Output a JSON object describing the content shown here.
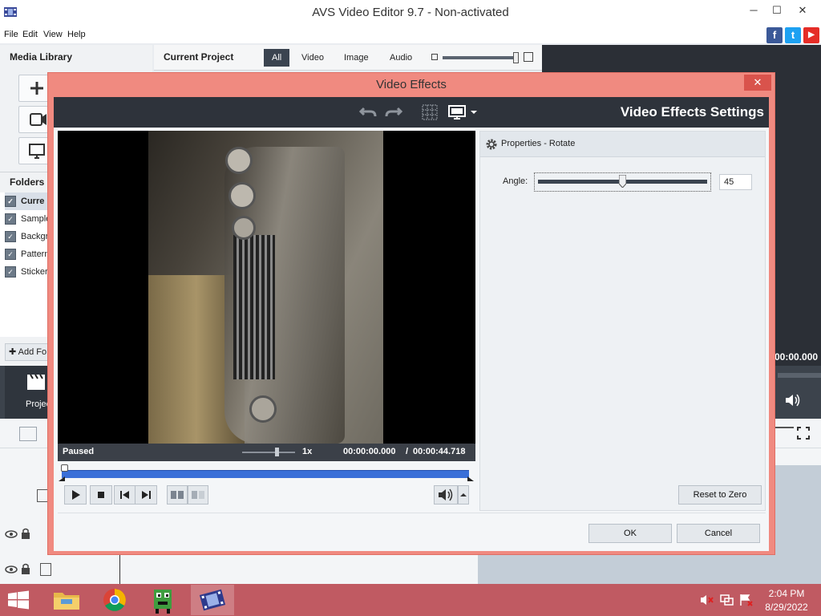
{
  "window": {
    "title": "AVS Video Editor 9.7 - Non-activated"
  },
  "menu": [
    "File",
    "Edit",
    "View",
    "Help"
  ],
  "social": [
    {
      "name": "facebook",
      "glyph": "f",
      "color": "#3b5998"
    },
    {
      "name": "twitter",
      "glyph": "t",
      "color": "#1da1f2"
    },
    {
      "name": "youtube",
      "glyph": "▶",
      "color": "#e52d27"
    }
  ],
  "left_panel": {
    "media_library": "Media Library",
    "folders_heading": "Folders",
    "folders": [
      "Curre",
      "Sample",
      "Backgr",
      "Pattern",
      "Sticker"
    ],
    "add_folder": "Add Fo",
    "project_label": "Projec"
  },
  "project_panel": {
    "title": "Current Project",
    "filters": [
      "All",
      "Video",
      "Image",
      "Audio"
    ],
    "active_filter": "All"
  },
  "right_fragment": {
    "time": "00:00.000"
  },
  "dialog": {
    "title": "Video Effects",
    "settings_title": "Video Effects Settings",
    "properties_title": "Properties - Rotate",
    "angle_label": "Angle:",
    "angle_value": "45",
    "angle_fraction": 0.5,
    "reset_button": "Reset to Zero",
    "ok_button": "OK",
    "cancel_button": "Cancel",
    "player": {
      "status": "Paused",
      "speed": "1x",
      "current_time": "00:00:00.000",
      "separator": "/",
      "total_time": "00:00:44.718"
    }
  },
  "taskbar": {
    "clock_time": "2:04 PM",
    "clock_date": "8/29/2022"
  }
}
